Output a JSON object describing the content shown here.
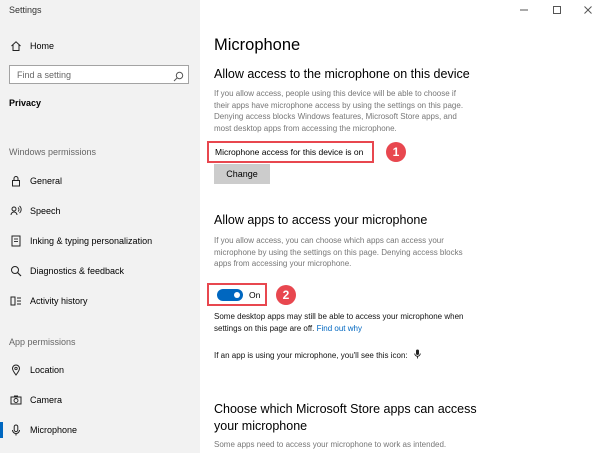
{
  "window": {
    "title": "Settings",
    "controls": [
      "minimize",
      "maximize",
      "close"
    ]
  },
  "sidebar": {
    "home": {
      "label": "Home",
      "icon": "home-icon"
    },
    "search": {
      "placeholder": "Find a setting",
      "icon": "search-icon"
    },
    "privacy_label": "Privacy",
    "windows_permissions_label": "Windows permissions",
    "windows_items": [
      {
        "label": "General",
        "icon": "lock-icon"
      },
      {
        "label": "Speech",
        "icon": "speech-icon"
      },
      {
        "label": "Inking & typing personalization",
        "icon": "inking-icon"
      },
      {
        "label": "Diagnostics & feedback",
        "icon": "diagnostics-icon"
      },
      {
        "label": "Activity history",
        "icon": "activity-icon"
      }
    ],
    "app_permissions_label": "App permissions",
    "app_items": [
      {
        "label": "Location",
        "icon": "location-icon"
      },
      {
        "label": "Camera",
        "icon": "camera-icon"
      },
      {
        "label": "Microphone",
        "icon": "microphone-icon",
        "active": true
      }
    ]
  },
  "main": {
    "title": "Microphone",
    "device_section": {
      "heading": "Allow access to the microphone on this device",
      "description_lines": [
        "If you allow access, people using this device will be able to choose if",
        "their apps have microphone access by using the settings on this page.",
        "Denying access blocks Windows features, Microsoft Store apps, and",
        "most desktop apps from accessing the microphone."
      ],
      "status": "Microphone access for this device is on",
      "change_button": "Change",
      "badge": "1"
    },
    "apps_section": {
      "heading": "Allow apps to access your microphone",
      "description_lines": [
        "If you allow access, you can choose which apps can access your",
        "microphone by using the settings on this page. Denying access blocks",
        "apps from accessing your microphone."
      ],
      "toggle_state": "On",
      "toggle_on": true,
      "badge": "2",
      "note_line1": "Some desktop apps may still be able to access your microphone when",
      "note_line2_prefix": "settings on this page are off.",
      "find_out_why": "Find out why",
      "icon_note": "If an app is using your microphone, you'll see this icon:"
    },
    "store_section": {
      "heading_line1": "Choose which Microsoft Store apps can access",
      "heading_line2": "your microphone",
      "description": "Some apps need to access your microphone to work as intended."
    }
  },
  "colors": {
    "sidebar_bg": "#f2f2f2",
    "accent": "#0067c0",
    "annotation_red": "#e8474f",
    "button_bg": "#cccccc"
  }
}
